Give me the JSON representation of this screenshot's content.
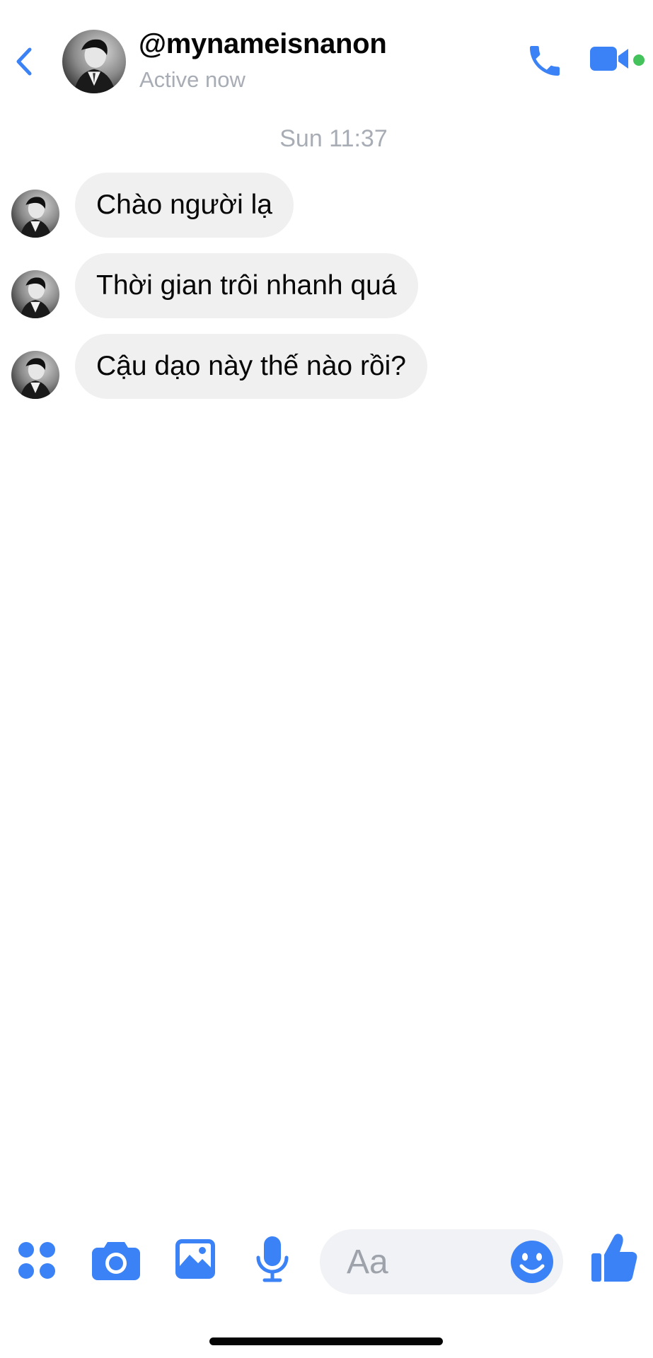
{
  "colors": {
    "accent": "#3b82f6",
    "bubble_bg": "#f0f0f0",
    "online": "#44c25b",
    "muted_text": "#a8adb5"
  },
  "header": {
    "back_icon": "chevron-left-icon",
    "contact_name": "@mynameisnanon",
    "status": "Active now",
    "call_icon": "phone-icon",
    "video_icon": "video-camera-icon"
  },
  "conversation": {
    "timestamp": "Sun 11:37",
    "messages": [
      {
        "text": "Chào người lạ"
      },
      {
        "text": "Thời gian trôi nhanh quá"
      },
      {
        "text": "Cậu dạo này thế nào rồi?"
      }
    ]
  },
  "composer": {
    "placeholder": "Aa",
    "value": "",
    "icons": [
      "apps-icon",
      "camera-icon",
      "gallery-icon",
      "microphone-icon",
      "emoji-icon",
      "thumbs-up-icon"
    ]
  }
}
